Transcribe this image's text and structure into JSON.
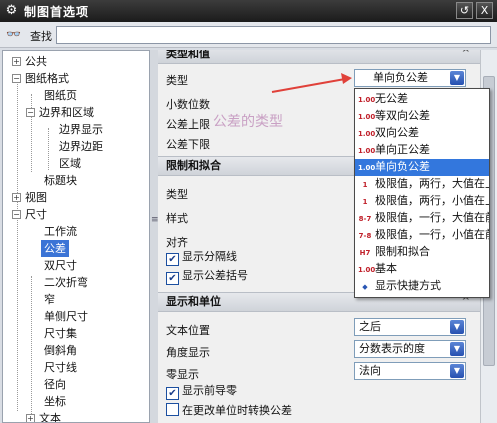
{
  "window": {
    "title": "制图首选项",
    "restore_label": "↺",
    "close_label": "X"
  },
  "search": {
    "label": "查找",
    "value": ""
  },
  "tree": {
    "items": [
      {
        "label": "公共"
      },
      {
        "label": "图纸格式"
      },
      {
        "label": "图纸页"
      },
      {
        "label": "边界和区域"
      },
      {
        "label": "边界显示"
      },
      {
        "label": "边界边距"
      },
      {
        "label": "区域"
      },
      {
        "label": "标题块"
      },
      {
        "label": "视图"
      },
      {
        "label": "尺寸"
      },
      {
        "label": "工作流"
      },
      {
        "label": "公差"
      },
      {
        "label": "双尺寸"
      },
      {
        "label": "二次折弯"
      },
      {
        "label": "窄"
      },
      {
        "label": "单侧尺寸"
      },
      {
        "label": "尺寸集"
      },
      {
        "label": "倒斜角"
      },
      {
        "label": "尺寸线"
      },
      {
        "label": "径向"
      },
      {
        "label": "坐标"
      },
      {
        "label": "文本"
      }
    ],
    "collapsed_sign": "+",
    "expanded_sign": "−"
  },
  "tolerance_section": {
    "header": "类型和值",
    "type_label": "类型",
    "type_value": "单向负公差",
    "decimals_label": "小数位数",
    "upper_label": "公差上限",
    "lower_label": "公差下限"
  },
  "annotation": {
    "text": "公差的类型"
  },
  "dropdown": {
    "items": [
      {
        "icon": "1.00",
        "label": "无公差"
      },
      {
        "icon": "1.00",
        "label": "等双向公差"
      },
      {
        "icon": "1.00",
        "label": "双向公差"
      },
      {
        "icon": "1.00",
        "label": "单向正公差"
      },
      {
        "icon": "1.00",
        "label": "单向负公差"
      },
      {
        "icon": "1",
        "label": "极限值，两行，大值在上"
      },
      {
        "icon": "1",
        "label": "极限值，两行，小值在上"
      },
      {
        "icon": "8-7",
        "label": "极限值，一行，大值在前"
      },
      {
        "icon": "7-8",
        "label": "极限值，一行，小值在前"
      },
      {
        "icon": "H7",
        "label": "限制和拟合"
      },
      {
        "icon": "1.00",
        "label": "基本"
      },
      {
        "icon": "◆",
        "label": "显示快捷方式"
      }
    ],
    "selected_index": 4
  },
  "limits_section": {
    "header": "限制和拟合",
    "type_label": "类型",
    "style_label": "样式",
    "align_label": "对齐",
    "show_separator": "显示分隔线",
    "show_brackets": "显示公差括号",
    "show_separator_checked": true,
    "show_brackets_checked": true
  },
  "display_section": {
    "header": "显示和单位",
    "text_pos_label": "文本位置",
    "text_pos_value": "之后",
    "angle_label": "角度显示",
    "angle_value": "分数表示的度",
    "zero_label": "零显示",
    "zero_value": "法向",
    "leading_zero": "显示前导零",
    "leading_zero_checked": true,
    "switch_units": "在更改单位时转换公差",
    "switch_units_checked": false
  },
  "colors": {
    "selection": "#3b74d6",
    "annotation_arrow": "#e0413a",
    "annotation_text": "#c9a0c4"
  }
}
